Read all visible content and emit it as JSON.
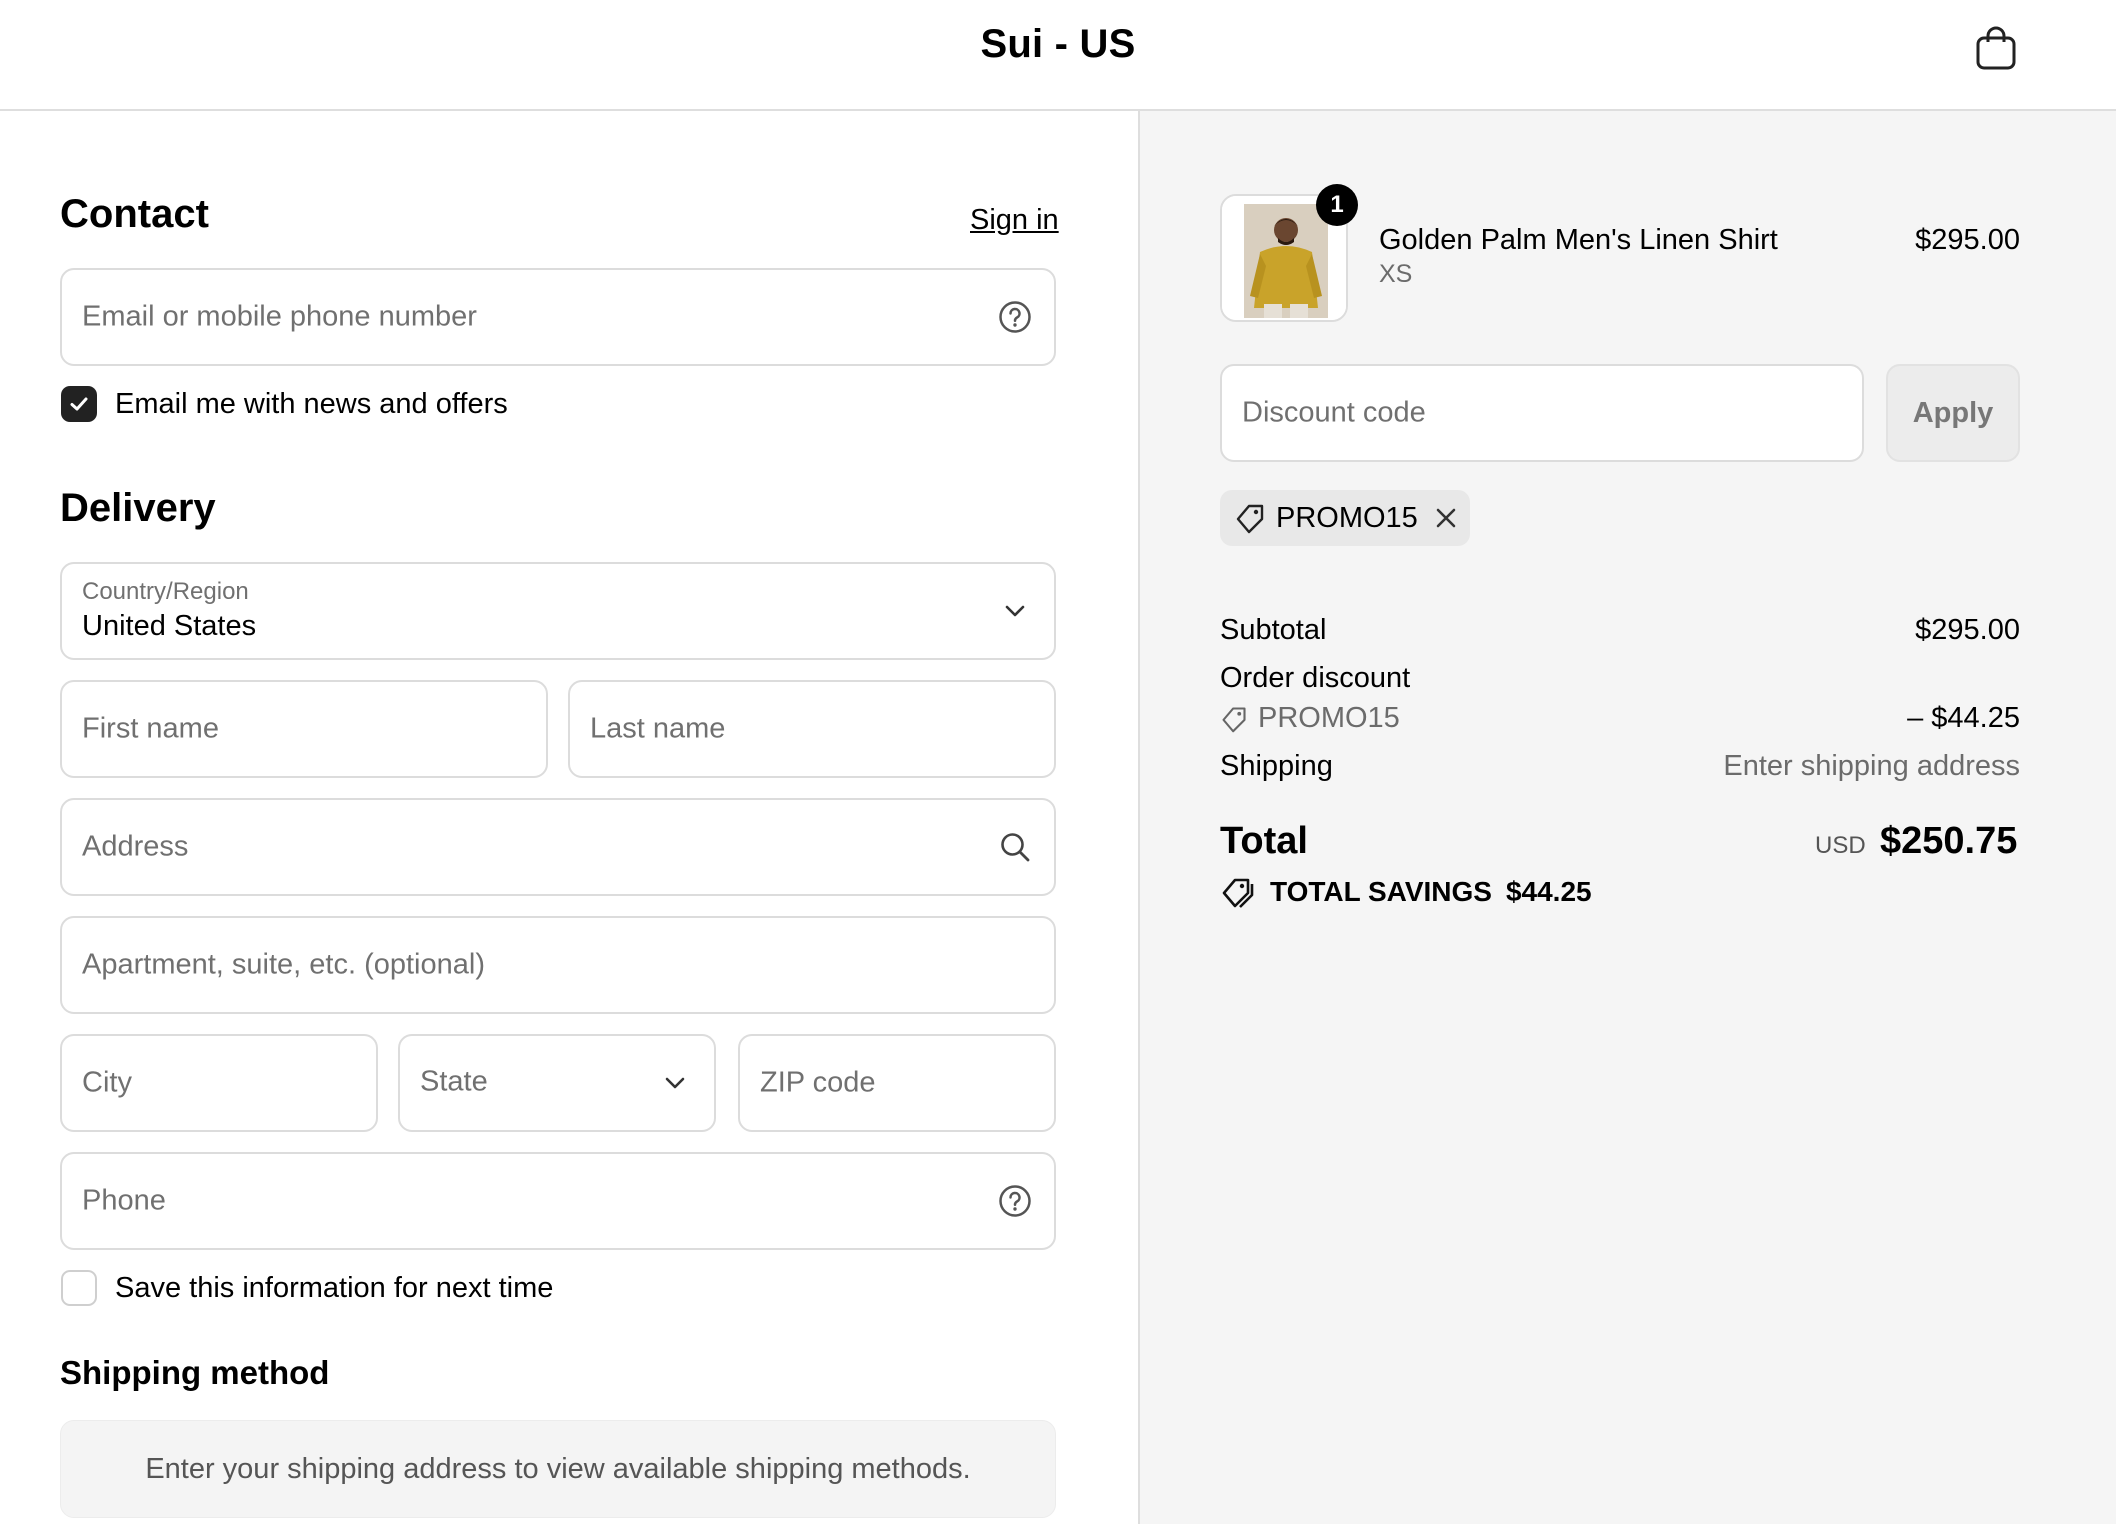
{
  "header": {
    "store_title": "Sui - US",
    "cart_icon": "shopping-bag-icon"
  },
  "contact": {
    "heading": "Contact",
    "sign_in": "Sign in",
    "email_placeholder": "Email or mobile phone number",
    "newsletter_label": "Email me with news and offers",
    "newsletter_checked": true
  },
  "delivery": {
    "heading": "Delivery",
    "country_label": "Country/Region",
    "country_value": "United States",
    "first_name_placeholder": "First name",
    "last_name_placeholder": "Last name",
    "address_placeholder": "Address",
    "apartment_placeholder": "Apartment, suite, etc. (optional)",
    "city_placeholder": "City",
    "state_placeholder": "State",
    "zip_placeholder": "ZIP code",
    "phone_placeholder": "Phone",
    "save_info_label": "Save this information for next time",
    "save_info_checked": false
  },
  "shipping_method": {
    "heading": "Shipping method",
    "message": "Enter your shipping address to view available shipping methods."
  },
  "order": {
    "item": {
      "name": "Golden Palm Men's Linen Shirt",
      "variant": "XS",
      "price": "$295.00",
      "quantity": "1"
    },
    "discount_placeholder": "Discount code",
    "apply_label": "Apply",
    "applied_code": "PROMO15",
    "subtotal_label": "Subtotal",
    "subtotal_value": "$295.00",
    "order_discount_label": "Order discount",
    "discount_code": "PROMO15",
    "discount_value": "– $44.25",
    "shipping_label": "Shipping",
    "shipping_value": "Enter shipping address",
    "total_label": "Total",
    "currency": "USD",
    "total_value": "$250.75",
    "savings_label": "TOTAL SAVINGS",
    "savings_value": "$44.25"
  }
}
